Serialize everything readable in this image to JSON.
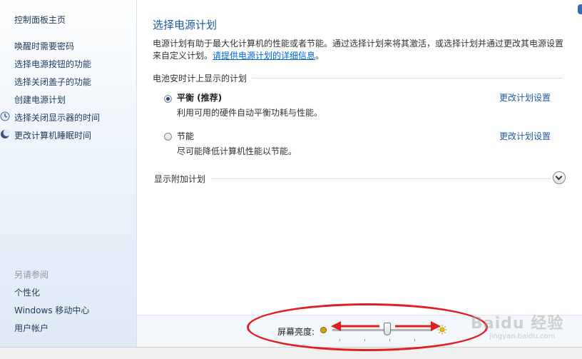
{
  "sidebar": {
    "home_label": "控制面板主页",
    "links": [
      {
        "label": "唤醒时需要密码"
      },
      {
        "label": "选择电源按钮的功能"
      },
      {
        "label": "选择关闭盖子的功能"
      },
      {
        "label": "创建电源计划"
      },
      {
        "label": "选择关闭显示器的时间",
        "icon": "monitor-clock-icon"
      },
      {
        "label": "更改计算机睡眠时间",
        "icon": "moon-icon"
      }
    ],
    "see_also_heading": "另请参阅",
    "see_also": [
      {
        "label": "个性化"
      },
      {
        "label": "Windows 移动中心"
      },
      {
        "label": "用户帐户"
      }
    ]
  },
  "main": {
    "title": "选择电源计划",
    "description": "电源计划有助于最大化计算机的性能或者节能。通过选择计划来将其激活，或选择计划并通过更改其电源设置来自定义计划。",
    "details_link": "请提供电源计划的详细信息",
    "description_end": "。",
    "section_label": "电池安时计上显示的计划",
    "plans": [
      {
        "name": "平衡 (推荐)",
        "desc": "利用可用的硬件自动平衡功耗与性能。",
        "link": "更改计划设置",
        "selected": true
      },
      {
        "name": "节能",
        "desc": "尽可能降低计算机性能以节能。",
        "link": "更改计划设置",
        "selected": false
      }
    ],
    "extra_plans_label": "显示附加计划"
  },
  "footer": {
    "brightness_label": "屏幕亮度:",
    "brightness_level": 0.55,
    "dim_icon": "dim-sun-icon",
    "bright_icon": "bright-sun-icon"
  },
  "overlay": {
    "watermark": "Baidu 经验",
    "watermark_sub": "jingyan.baidu.com",
    "annotation_color": "#e02020"
  },
  "colors": {
    "accent": "#1e5aa0",
    "link": "#0066cc"
  }
}
